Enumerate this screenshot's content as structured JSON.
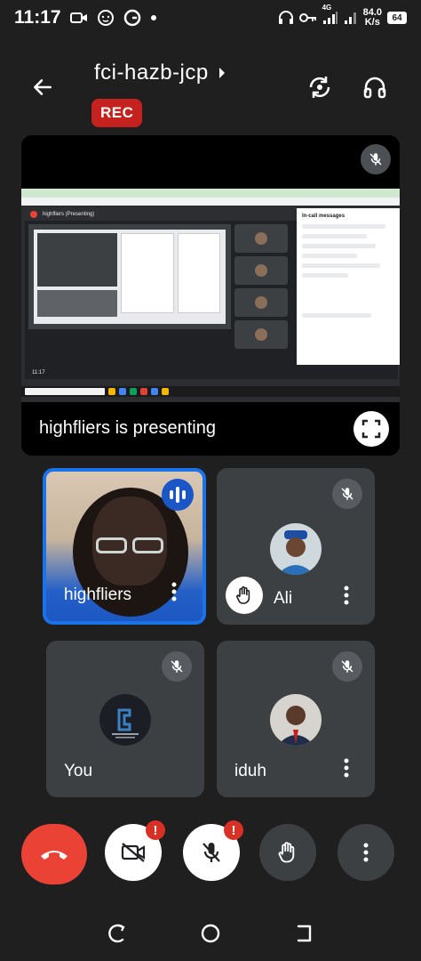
{
  "status_bar": {
    "time": "11:17",
    "network": "4G",
    "speed_value": "84.0",
    "speed_unit": "K/s",
    "battery": "64"
  },
  "header": {
    "meeting_code": "fci-hazb-jcp",
    "rec_label": "REC"
  },
  "presentation": {
    "label": "highfliers is presenting",
    "inner_meeting_title": "highfliers (Presenting)",
    "inner_chat_title": "In-call messages",
    "inner_time": "11:17"
  },
  "participants": [
    {
      "name": "highfliers",
      "speaking": true
    },
    {
      "name": "Ali",
      "hand_raised": true,
      "muted": true
    },
    {
      "name": "You",
      "muted": true
    },
    {
      "name": "iduh",
      "muted": true
    }
  ],
  "controls": {
    "camera_badge": "!",
    "mic_badge": "!"
  },
  "colors": {
    "background": "#1f1f20",
    "tile": "#3c4043",
    "rec": "#c5221f",
    "end_call": "#ea4335",
    "active_border": "#1a73e8"
  }
}
